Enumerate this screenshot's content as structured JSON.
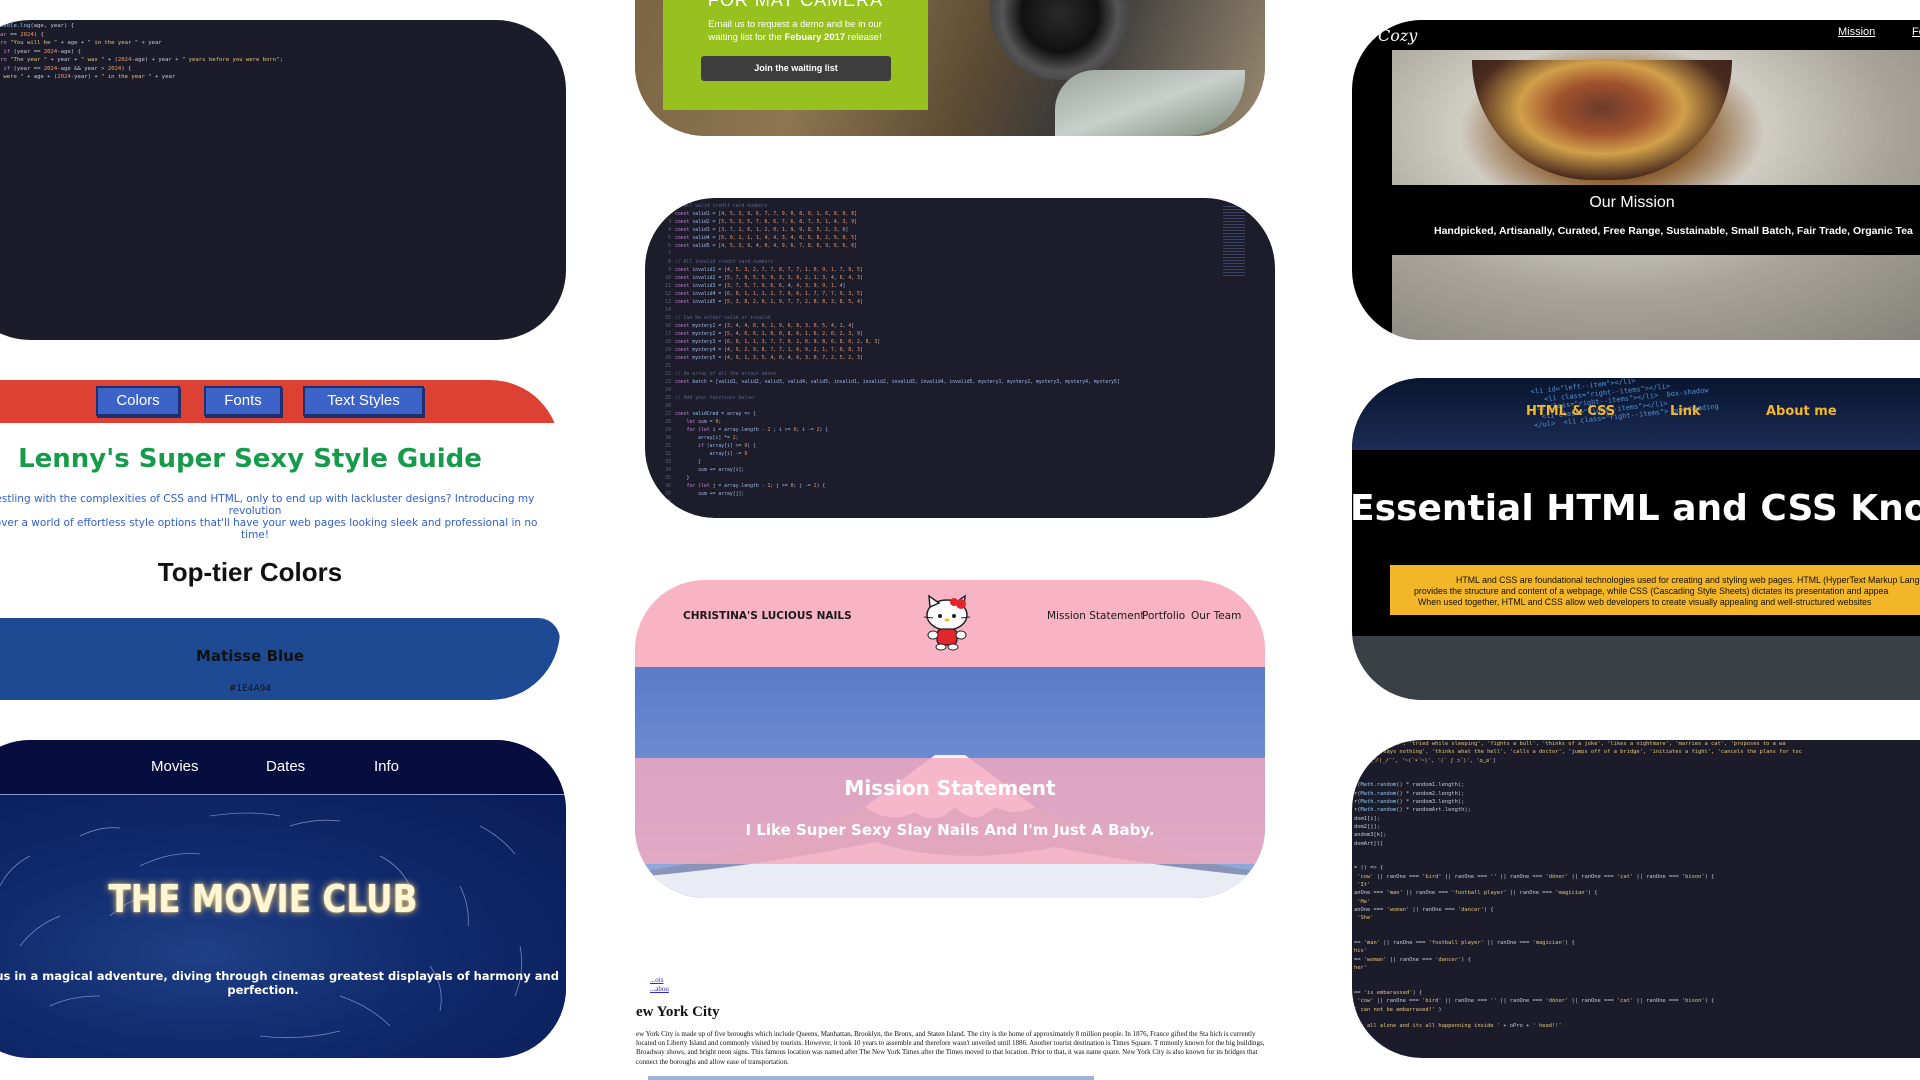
{
  "style_guide": {
    "nav": [
      "Colors",
      "Fonts",
      "Text Styles"
    ],
    "title": "Lenny's Super Sexy Style Guide",
    "intro_line1": "f wrestling with the complexities of CSS and HTML, only to end up with lackluster designs? Introducing my revolution",
    "intro_line2": "Discover a world of effortless style options that'll have your web pages looking sleek and professional in no time!",
    "subtitle": "Top-tier Colors",
    "swatch_name": "Matisse Blue",
    "swatch_hex": "#1E4A94",
    "swatch_color": "#1E4A94"
  },
  "movie_club": {
    "nav": [
      "Movies",
      "Dates",
      "Info"
    ],
    "title": "THE MOVIE CLUB",
    "tagline": "Join us in a magical adventure, diving through cinemas greatest displayals of harmony and perfection."
  },
  "camera": {
    "title": "FOR MAT CAMERA",
    "text_line1": "Email us to request a demo and be in our",
    "text_line2_prefix": "waiting list for the ",
    "text_line2_bold": "Febuary 2017",
    "text_line2_suffix": " release!",
    "button": "Join the waiting list",
    "accent": "#97C11F"
  },
  "nails": {
    "brand": "CHRISTINA'S LUCIOUS NAILS",
    "nav": [
      "Mission Statement",
      "Portfolio",
      "Our Team"
    ],
    "hero_title": "Mission Statement",
    "hero_sub": "I Like Super Sexy Slay Nails And I'm Just A Baby.",
    "accent": "#F8B4C4"
  },
  "nyc": {
    "links": [
      "...ois",
      "...abou"
    ],
    "heading": "ew York City",
    "paragraph": "ew York City is made up of five boroughs which include Queens, Manhattan, Brooklyn, the Bronx, and Staten Island. The city is the home of approximately 8 million people. In 1876, France gifted the Sta hich is currently located on Liberty Island and commonly visited by tourists. However, it took 10 years to assemble and therefore wasn't unveiled until 1886. Another tourist destination is Times Square. T mmonly known for the big buildings, Broadway shows, and bright neon signs. This famous location was named after The New York Times after the Times moved to that location. Prior to that, it was name quare. New York City is also known for its bridges that connect the boroughs and allow ease of transportation."
  },
  "cozy": {
    "logo": "Cozy",
    "nav": [
      "Mission",
      "Featu"
    ],
    "band_title": "Our Mission",
    "band_sub": "Handpicked, Artisanally, Curated, Free Range, Sustainable, Small Batch, Fair Trade, Organic Tea"
  },
  "essential": {
    "nav": [
      "HTML & CSS",
      "Link",
      "About me"
    ],
    "headline": "Essential HTML and CSS Knowle",
    "box_line1": "HTML and CSS are foundational technologies used for creating and styling web pages. HTML (HyperText Markup Langu",
    "box_line2": "provides the structure and content of a webpage, while CSS (Cascading Style Sheets) dictates its presentation and appea",
    "box_line3": "When used together, HTML and CSS allow web developers to create visually appealing and well-structured websites",
    "accent": "#F2B628"
  }
}
